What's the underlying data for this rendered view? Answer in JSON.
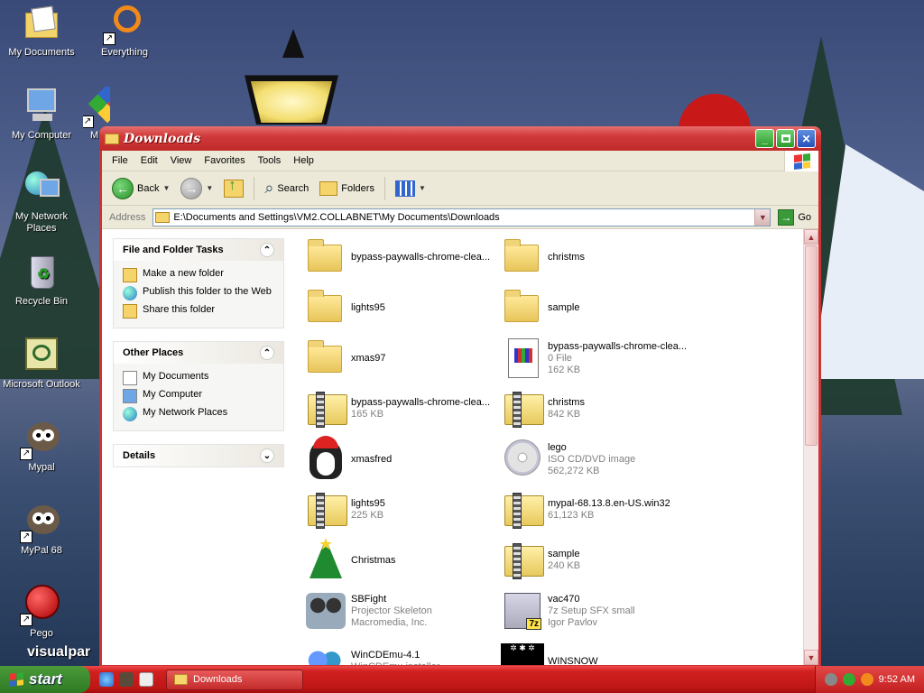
{
  "desktop": {
    "icons": [
      {
        "label": "My Documents",
        "icon": "my-documents-icon"
      },
      {
        "label": "Everything",
        "icon": "everything-icon"
      },
      {
        "label": "My Computer",
        "icon": "my-computer-icon"
      },
      {
        "label": "My Network Places",
        "icon": "network-places-icon"
      },
      {
        "label": "Recycle Bin",
        "icon": "recycle-bin-icon"
      },
      {
        "label": "Microsoft Outlook",
        "icon": "outlook-icon"
      },
      {
        "label": "Mypal",
        "icon": "mypal-icon"
      },
      {
        "label": "MyPal 68",
        "icon": "mypal68-icon"
      },
      {
        "label": "Pego",
        "icon": "pego-icon"
      },
      {
        "label": "visualpar",
        "icon": "visualpar-icon"
      },
      {
        "label": "M",
        "icon": "unknown-app-icon"
      }
    ]
  },
  "window": {
    "title": "Downloads",
    "menu": [
      "File",
      "Edit",
      "View",
      "Favorites",
      "Tools",
      "Help"
    ],
    "toolbar": {
      "back_label": "Back",
      "search_label": "Search",
      "folders_label": "Folders"
    },
    "address": {
      "label": "Address",
      "value": "E:\\Documents and Settings\\VM2.COLLABNET\\My Documents\\Downloads",
      "go_label": "Go"
    },
    "task_panels": {
      "file_folder": {
        "title": "File and Folder Tasks",
        "items": [
          "Make a new folder",
          "Publish this folder to the Web",
          "Share this folder"
        ]
      },
      "other_places": {
        "title": "Other Places",
        "items": [
          "My Documents",
          "My Computer",
          "My Network Places"
        ]
      },
      "details": {
        "title": "Details"
      }
    },
    "files": [
      {
        "name": "bypass-paywalls-chrome-clea...",
        "line2": "",
        "line3": "",
        "icon": "folder"
      },
      {
        "name": "christms",
        "line2": "",
        "line3": "",
        "icon": "folder"
      },
      {
        "name": "lights95",
        "line2": "",
        "line3": "",
        "icon": "folder"
      },
      {
        "name": "sample",
        "line2": "",
        "line3": "",
        "icon": "folder"
      },
      {
        "name": "xmas97",
        "line2": "",
        "line3": "",
        "icon": "folder"
      },
      {
        "name": "bypass-paywalls-chrome-clea...",
        "line2": "0 File",
        "line3": "162 KB",
        "icon": "doc"
      },
      {
        "name": "bypass-paywalls-chrome-clea...",
        "line2": "165 KB",
        "line3": "",
        "icon": "zip"
      },
      {
        "name": "christms",
        "line2": "842 KB",
        "line3": "",
        "icon": "zip"
      },
      {
        "name": "xmasfred",
        "line2": "",
        "line3": "",
        "icon": "penguin"
      },
      {
        "name": "lego",
        "line2": "ISO CD/DVD image",
        "line3": "562,272 KB",
        "icon": "disc"
      },
      {
        "name": "lights95",
        "line2": "225 KB",
        "line3": "",
        "icon": "zip"
      },
      {
        "name": "mypal-68.13.8.en-US.win32",
        "line2": "61,123 KB",
        "line3": "",
        "icon": "zip"
      },
      {
        "name": "Christmas",
        "line2": "",
        "line3": "",
        "icon": "tree"
      },
      {
        "name": "sample",
        "line2": "240 KB",
        "line3": "",
        "icon": "zip"
      },
      {
        "name": "SBFight",
        "line2": "Projector Skeleton",
        "line3": "Macromedia, Inc.",
        "icon": "reel"
      },
      {
        "name": "vac470",
        "line2": "7z Setup SFX small",
        "line3": "Igor Pavlov",
        "icon": "installer"
      },
      {
        "name": "WinCDEmu-4.1",
        "line2": "WinCDEmu installer",
        "line3": "",
        "icon": "cdemu"
      },
      {
        "name": "WINSNOW",
        "line2": "",
        "line3": "",
        "icon": "snowbox"
      }
    ]
  },
  "taskbar": {
    "start_label": "start",
    "task_button_label": "Downloads",
    "clock": "9:52 AM"
  }
}
